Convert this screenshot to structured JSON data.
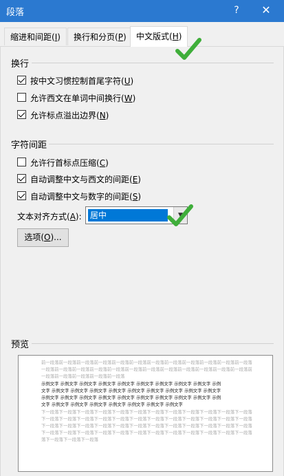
{
  "window": {
    "title": "段落",
    "help": "?",
    "close": "✕"
  },
  "tabs": [
    {
      "label": "缩进和间距(",
      "key": "I",
      "end": ")"
    },
    {
      "label": "换行和分页(",
      "key": "P",
      "end": ")"
    },
    {
      "label": "中文版式(",
      "key": "H",
      "end": ")"
    }
  ],
  "line_break": {
    "title": "换行",
    "options": [
      {
        "label": "按中文习惯控制首尾字符(",
        "key": "U",
        "end": ")",
        "checked": true
      },
      {
        "label": "允许西文在单词中间换行(",
        "key": "W",
        "end": ")",
        "checked": false
      },
      {
        "label": "允许标点溢出边界(",
        "key": "N",
        "end": ")",
        "checked": true
      }
    ]
  },
  "char_spacing": {
    "title": "字符间距",
    "options": [
      {
        "label": "允许行首标点压缩(",
        "key": "C",
        "end": ")",
        "checked": false
      },
      {
        "label": "自动调整中文与西文的间距(",
        "key": "E",
        "end": ")",
        "checked": true
      },
      {
        "label": "自动调整中文与数字的间距(",
        "key": "S",
        "end": ")",
        "checked": true
      }
    ]
  },
  "text_align": {
    "label": "文本对齐方式(",
    "key": "A",
    "end": "):",
    "value": "居中"
  },
  "options_button": {
    "label": "选项(",
    "key": "O",
    "end": ")..."
  },
  "preview": {
    "title": "预览",
    "prev_line_1": "前一段落前一段落前一段落前一段落前一段落前一段落前一段落前一段落前一段落前一段落前一段落前一段落",
    "prev_line_2": "一段落前一段落前一段落前一段落前一段落前一段落前一段落前一段落前一段落前一段落前一段落前一段落前",
    "prev_line_3": "一段落前一段落前一段落前一段落前一段落",
    "sample_1": "示例文字  示例文字  示例文字  示例文字  示例文字  示例文字  示例文字  示例文字  示例文字  示例",
    "sample_2": "文字  示例文字  示例文字  示例文字  示例文字  示例文字  示例文字  示例文字  示例文字  示例文字",
    "sample_3": "示例文字  示例文字  示例文字  示例文字  示例文字  示例文字  示例文字  示例文字  示例文字  示例",
    "sample_4": "文字  示例文字  示例文字  示例文字  示例文字  示例文字  示例文字  示例文字",
    "next_line_1": "下一段落下一段落下一段落下一段落下一段落下一段落下一段落下一段落下一段落下一段落下一段落下一段落",
    "next_line_2": "下一段落下一段落下一段落下一段落下一段落下一段落下一段落下一段落下一段落下一段落下一段落下一段落",
    "next_line_3": "下一段落下一段落下一段落下一段落下一段落下一段落下一段落下一段落下一段落下一段落下一段落下一段落",
    "next_line_4": "下一段落下一段落下一段落下一段落下一段落下一段落下一段落下一段落下一段落下一段落下一段落下一段落",
    "next_line_5": "落下一段落下一段落下一段落"
  },
  "colors": {
    "titlebar": "#2b79d0",
    "selection": "#0078d7",
    "checkmark_annotation": "#3fae3a"
  },
  "icons": {
    "checkmark_annotation": "green-checkmark-icon",
    "dropdown": "chevron-down-icon"
  }
}
